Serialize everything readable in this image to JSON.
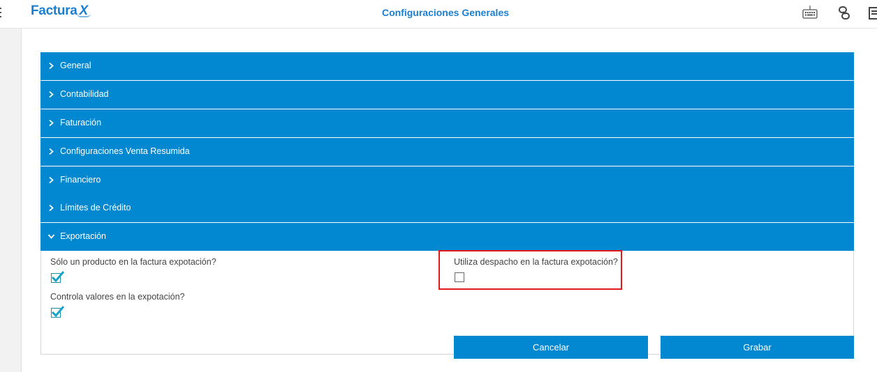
{
  "app": {
    "brand_main": "Factura",
    "brand_x": "X",
    "page_title": "Configuraciones Generales",
    "accent": "#0288d1",
    "brand_color": "#1a7fd0"
  },
  "toolbar": {
    "icons": [
      "keyboard-icon",
      "link-icon",
      "document-icon"
    ]
  },
  "accordion": {
    "sections": [
      {
        "label": "General",
        "expanded": false
      },
      {
        "label": "Contabilidad",
        "expanded": false
      },
      {
        "label": "Faturación",
        "expanded": false
      },
      {
        "label": "Configuraciones Venta Resumida",
        "expanded": false
      },
      {
        "label": "Financiero",
        "expanded": false
      },
      {
        "label": "Límites de Crédito",
        "expanded": false
      },
      {
        "label": "Exportación",
        "expanded": true
      }
    ]
  },
  "exportacion": {
    "fields": [
      {
        "label": "Sólo un producto en la factura expotación?",
        "checked": true
      },
      {
        "label": "Controla valores en la expotación?",
        "checked": true
      },
      {
        "label": "Utiliza despacho en la factura expotación?",
        "checked": false
      }
    ],
    "highlight_color": "#e01a1a"
  },
  "actions": {
    "cancel_label": "Cancelar",
    "save_label": "Grabar"
  }
}
